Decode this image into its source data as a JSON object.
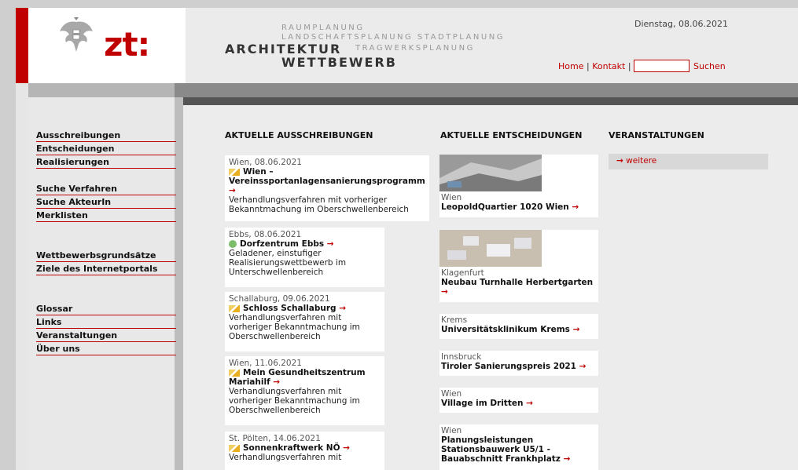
{
  "header": {
    "logo_text": "zt:",
    "line_raumplanung": "RAUMPLANUNG",
    "line_landschaft": "LANDSCHAFTSPLANUNG STADTPLANUNG",
    "line_architektur": "ARCHITEKTUR",
    "line_tragwerk": "TRAGWERKSPLANUNG",
    "line_wettbewerb": "WETTBEWERB",
    "date": "Dienstag, 08.06.2021",
    "home_link": "Home",
    "separator": "|",
    "kontakt_link": "Kontakt",
    "search_value": "",
    "search_button": "Suchen"
  },
  "sidebar": {
    "group1": [
      "Ausschreibungen",
      "Entscheidungen",
      "Realisierungen"
    ],
    "group2": [
      "Suche Verfahren",
      "Suche AkteurIn",
      "Merklisten"
    ],
    "group3": [
      "Wettbewerbsgrundsätze",
      "Ziele des Internetportals"
    ],
    "group4": [
      "Glossar",
      "Links",
      "Veranstaltungen",
      "Über uns"
    ]
  },
  "columns": {
    "ausschreibungen_title": "AKTUELLE AUSSCHREIBUNGEN",
    "entscheidungen_title": "AKTUELLE ENTSCHEIDUNGEN",
    "veranstaltungen_title": "VERANSTALTUNGEN"
  },
  "ausschreibungen": [
    {
      "loc": "Wien, 08.06.2021",
      "title": "Wien – Vereinssportanlagensanierungsprogramm",
      "desc": "Verhandlungsverfahren mit vorheriger Bekanntmachung im Oberschwellenbereich"
    },
    {
      "loc": "Ebbs, 08.06.2021",
      "title": "Dorfzentrum Ebbs",
      "desc": "Geladener, einstufiger Realisierungswettbewerb im Unterschwellenbereich"
    },
    {
      "loc": "Schallaburg, 09.06.2021",
      "title": "Schloss Schallaburg",
      "desc": "Verhandlungsverfahren mit vorheriger Bekanntmachung im Oberschwellenbereich"
    },
    {
      "loc": "Wien, 11.06.2021",
      "title": "Mein Gesundheitszentrum Mariahilf",
      "desc": "Verhandlungsverfahren mit vorheriger Bekanntmachung im Oberschwellenbereich"
    },
    {
      "loc": "St. Pölten, 14.06.2021",
      "title": "Sonnenkraftwerk NÖ",
      "desc": "Verhandlungsverfahren mit"
    }
  ],
  "entscheidungen": [
    {
      "loc": "Wien",
      "title": "LeopoldQuartier 1020 Wien"
    },
    {
      "loc": "Klagenfurt",
      "title": "Neubau Turnhalle Herbertgarten"
    },
    {
      "loc": "Krems",
      "title": "Universitätsklinikum Krems"
    },
    {
      "loc": "Innsbruck",
      "title": "Tiroler Sanierungspreis 2021"
    },
    {
      "loc": "Wien",
      "title": "Village im Dritten"
    },
    {
      "loc": "Wien",
      "title": "Planungsleistungen Stationsbauwerk U5/1 - Bauabschnitt Frankhplatz"
    }
  ],
  "veranstaltungen": {
    "weitere": "weitere"
  },
  "arrow": "→"
}
